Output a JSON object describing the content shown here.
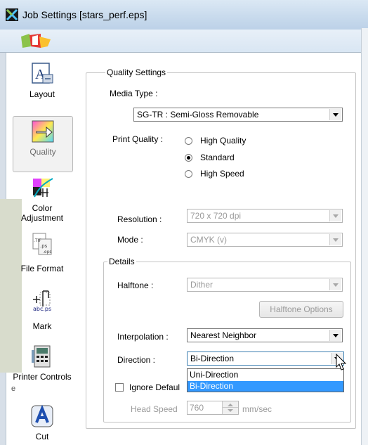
{
  "window": {
    "title": "Job Settings [stars_perf.eps]",
    "icon": "app-x-icon"
  },
  "sidebar": {
    "items": [
      {
        "label": "Layout",
        "icon": "layout-icon",
        "active": false
      },
      {
        "label": "Quality",
        "icon": "quality-icon",
        "active": true
      },
      {
        "label": "Color Adjustment",
        "icon": "color-adjustment-icon",
        "active": false
      },
      {
        "label": "File Format",
        "icon": "file-format-icon",
        "active": false
      },
      {
        "label": "Mark",
        "icon": "mark-icon",
        "active": false
      },
      {
        "label": "Printer Controls",
        "icon": "printer-controls-icon",
        "active": false
      },
      {
        "label": "Cut",
        "icon": "cut-icon",
        "active": false
      }
    ]
  },
  "quality_settings": {
    "caption": "Quality Settings",
    "media_type_label": "Media Type :",
    "media_type_value": "SG-TR : Semi-Gloss Removable",
    "print_quality_label": "Print Quality :",
    "print_quality_options": [
      "High Quality",
      "Standard",
      "High Speed"
    ],
    "print_quality_selected": "Standard",
    "resolution_label": "Resolution :",
    "resolution_value": "720 x 720 dpi",
    "mode_label": "Mode :",
    "mode_value": "CMYK (v)"
  },
  "details": {
    "caption": "Details",
    "halftone_label": "Halftone :",
    "halftone_value": "Dither",
    "halftone_options_button": "Halftone Options",
    "interpolation_label": "Interpolation :",
    "interpolation_value": "Nearest Neighbor",
    "direction_label": "Direction :",
    "direction_value": "Bi-Direction",
    "direction_options": [
      "Uni-Direction",
      "Bi-Direction"
    ],
    "direction_highlighted": "Bi-Direction",
    "ignore_default_label": "Ignore Defaul",
    "head_speed_label": "Head Speed",
    "head_speed_value": "760",
    "head_speed_unit": "mm/sec"
  },
  "background": {
    "peek_text": "e"
  },
  "colors": {
    "selection": "#3399ff",
    "disabled_text": "#9a9a9a"
  }
}
